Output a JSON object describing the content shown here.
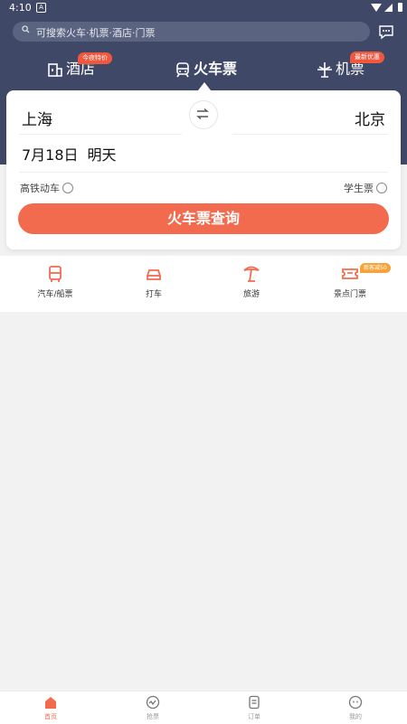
{
  "status_bar": {
    "time": "4:10",
    "app_indicator": "A"
  },
  "header": {
    "search_placeholder": "可搜索火车·机票·酒店·门票"
  },
  "tabs": [
    {
      "label": "酒店",
      "tag": "今夜特价",
      "icon": "hotel-icon"
    },
    {
      "label": "火车票",
      "icon": "train-icon",
      "active": true
    },
    {
      "label": "机票",
      "tag": "最新优惠",
      "icon": "plane-icon"
    }
  ],
  "search_card": {
    "from_city": "上海",
    "to_city": "北京",
    "date": "7月18日",
    "day_label": "明天",
    "option_gaotie": "高铁动车",
    "option_student": "学生票",
    "submit_label": "火车票查询"
  },
  "quick_links": [
    {
      "label": "汽车/船票",
      "icon": "bus-icon"
    },
    {
      "label": "打车",
      "icon": "car-icon"
    },
    {
      "label": "旅游",
      "icon": "palm-tree-icon"
    },
    {
      "label": "景点门票",
      "icon": "ticket-icon",
      "tag": "新客减50"
    }
  ],
  "bottom_nav": [
    {
      "label": "首页",
      "icon": "home-icon",
      "active": true
    },
    {
      "label": "抢票",
      "icon": "grab-ticket-icon"
    },
    {
      "label": "订单",
      "icon": "order-icon"
    },
    {
      "label": "我的",
      "icon": "profile-icon"
    }
  ],
  "colors": {
    "header_bg": "#3f4866",
    "accent": "#f26b4e",
    "tag_red": "#f0573e",
    "tag_orange": "#f6a33a"
  }
}
